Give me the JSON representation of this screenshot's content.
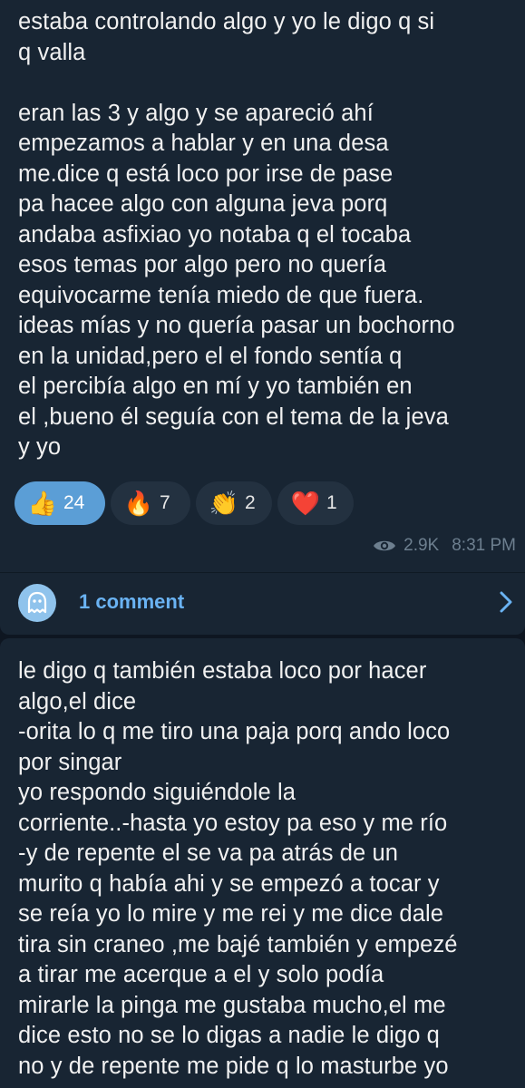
{
  "post1": {
    "text": "estaba controlando algo y yo le digo q si\nq valla\n\neran las 3 y algo y se apareció ahí\nempezamos a hablar y en una desa\nme.dice q está loco por irse de pase\npa hacee algo con alguna jeva porq\nandaba asfixiao yo notaba q el tocaba\nesos temas por algo pero no quería\nequivocarme tenía miedo de que fuera.\nideas mías y no quería pasar un bochorno\nen la unidad,pero el el fondo sentía q\nel percibía algo en mí y yo también en\nel ,bueno él seguía con el tema de la jeva\ny yo",
    "reactions": [
      {
        "emoji": "👍",
        "count": "24",
        "active": true
      },
      {
        "emoji": "🔥",
        "count": "7",
        "active": false
      },
      {
        "emoji": "👏",
        "count": "2",
        "active": false
      },
      {
        "emoji": "❤️",
        "count": "1",
        "active": false
      }
    ],
    "views": "2.9K",
    "time": "8:31 PM",
    "comments_label": "1 comment"
  },
  "post2": {
    "text": "le digo q también estaba loco por hacer\nalgo,el dice\n-orita lo q me tiro una paja porq ando loco\npor singar\nyo respondo siguiéndole la\ncorriente..-hasta yo estoy pa eso y me río\n-y de repente el se va pa atrás de un\nmurito q había ahi y se empezó a tocar y\nse reía yo lo mire y me rei y me dice dale\ntira sin craneo ,me bajé también y empezé\na tirar me acerque a el y solo podía\nmirarle la pinga me gustaba mucho,el me\ndice esto no se lo digas a nadie le digo q\nno y de repente me pide q lo masturbe yo"
  },
  "colors": {
    "background": "#0e1621",
    "bubble": "#182533",
    "accent": "#6ab3f3",
    "active_reaction": "#5b9ed6"
  },
  "icons": {
    "views": "eye-icon",
    "comments": "ghost-icon",
    "open": "chevron-right-icon"
  }
}
